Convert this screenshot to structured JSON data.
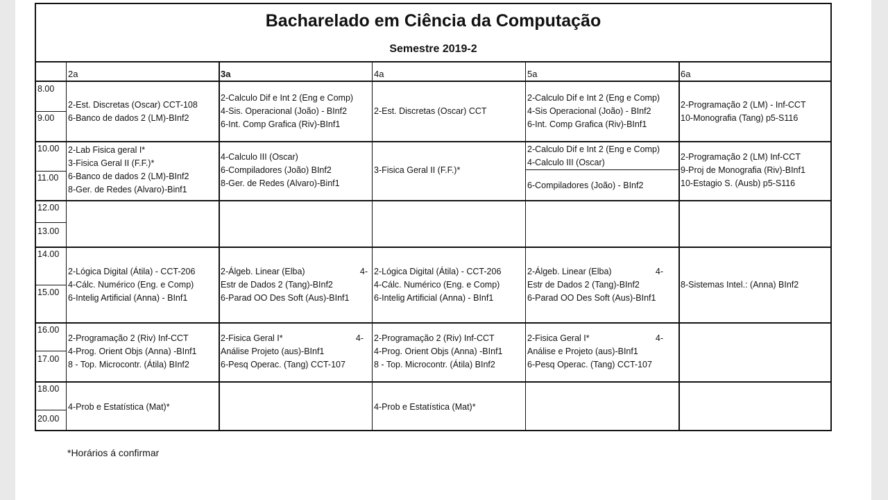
{
  "header": {
    "title": "Bacharelado em Ciência da Computação",
    "semester": "Semestre 2019-2"
  },
  "days": [
    "2a",
    "3a",
    "4a",
    "5a",
    "6a"
  ],
  "times": [
    "8.00",
    "9.00",
    "10.00",
    "11.00",
    "12.00",
    "13.00",
    "14.00",
    "15.00",
    "16.00",
    "17.00",
    "18.00",
    "20.00"
  ],
  "cells": {
    "b1_2a": [
      "2-Est. Discretas (Oscar) CCT-108",
      "6-Banco de dados 2 (LM)-BInf2"
    ],
    "b1_3a": [
      "2-Calculo Dif e Int 2 (Eng e Comp)",
      "4-Sis. Operacional (João) - BInf2",
      "6-Int. Comp Grafica  (Riv)-BInf1"
    ],
    "b1_4a": [
      "2-Est. Discretas (Oscar) CCT"
    ],
    "b1_5a": [
      "2-Calculo Dif e Int 2 (Eng e Comp)",
      "4-Sis Operacional (João) - BInf2",
      "6-Int. Comp Grafica  (Riv)-BInf1"
    ],
    "b1_6a": [
      "2-Programação 2 (LM)  - Inf-CCT",
      "10-Monografia (Tang) p5-S116"
    ],
    "b2_2a": [
      "2-Lab Fisica geral I*",
      "3-Fisica Geral II (F.F.)*",
      "6-Banco de dados 2 (LM)-BInf2",
      "8-Ger. de Redes (Alvaro)-Binf1"
    ],
    "b2_3a": [
      "4-Calculo III  (Oscar)",
      "6-Compiladores (João) BInf2",
      "8-Ger. de Redes (Alvaro)-Binf1"
    ],
    "b2_4a": [
      "3-Fisica Geral II (F.F.)*"
    ],
    "b2_5a_top": [
      "2-Calculo Dif e Int 2 (Eng e Comp)",
      "4-Calculo III  (Oscar)"
    ],
    "b2_5a_bottom": [
      "6-Compiladores (João) - BInf2"
    ],
    "b2_6a": [
      "2-Programação 2 (LM)  Inf-CCT",
      "9-Proj de Monografia (Riv)-BInf1",
      "10-Estagio S. (Ausb) p5-S116"
    ],
    "b4_2a": [
      "2-Lógica Digital  (Átila) - CCT-206",
      "4-Cálc. Numérico (Eng. e Comp)",
      "6-Intelig Artificial (Anna) - BInf1"
    ],
    "b4_3a": [
      "2-Álgeb. Linear (Elba)",
      "Estr de Dados 2  (Tang)-BInf2",
      "6-Parad OO Des Soft  (Aus)-BInf1"
    ],
    "b4_3a_num": "4-",
    "b4_4a": [
      "2-Lógica Digital  (Átila) - CCT-206",
      "4-Cálc. Numérico (Eng. e Comp)",
      "6-Intelig Artificial (Anna) - BInf1"
    ],
    "b4_5a": [
      "2-Álgeb. Linear (Elba)",
      "Estr de Dados 2  (Tang)-BInf2",
      "6-Parad OO Des Soft  (Aus)-BInf1"
    ],
    "b4_5a_num": "4-",
    "b4_6a": [
      "8-Sistemas Intel.: (Anna) BInf2"
    ],
    "b5_2a": [
      "2-Programação 2 (Riv)  Inf-CCT",
      "4-Prog. Orient Objs (Anna) -BInf1",
      "8 - Top. Microcontr. (Átila) BInf2"
    ],
    "b5_3a": [
      "2-Fisica Geral I*",
      "Análise Projeto (aus)-BInf1",
      "6-Pesq Operac. (Tang) CCT-107"
    ],
    "b5_3a_num": "4-",
    "b5_4a": [
      "2-Programação 2 (Riv)  Inf-CCT",
      "4-Prog. Orient Objs (Anna) -BInf1",
      "8 - Top. Microcontr. (Átila) BInf2"
    ],
    "b5_5a": [
      "2-Fisica Geral I*",
      "Análise e Projeto (aus)-BInf1",
      "6-Pesq Operac. (Tang) CCT-107"
    ],
    "b5_5a_num": "4-",
    "b6_2a": [
      "4-Prob e Estatística (Mat)*"
    ],
    "b6_4a": [
      "4-Prob e Estatística (Mat)*"
    ]
  },
  "footnote": "*Horários á confirmar"
}
